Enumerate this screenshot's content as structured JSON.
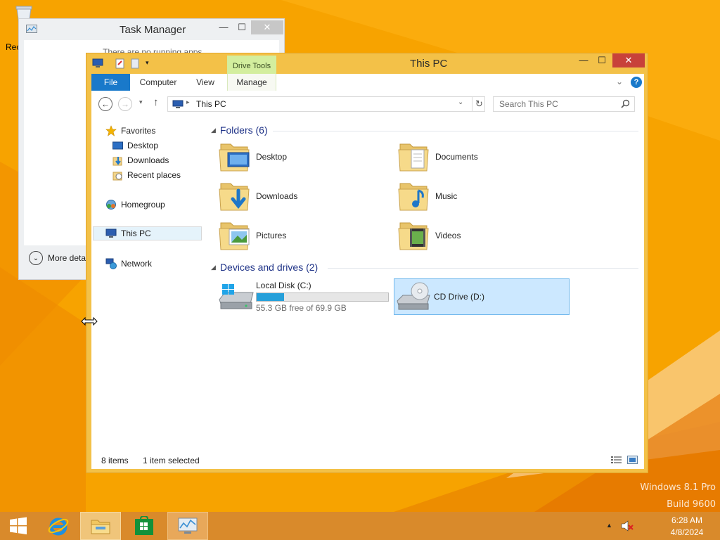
{
  "desktop": {
    "recycle_bin_label": "Rec",
    "watermark_line1": "Windows 8.1 Pro",
    "watermark_line2": "Build 9600"
  },
  "task_manager": {
    "title": "Task Manager",
    "empty_message": "There are no running apps",
    "more_details_label": "More deta",
    "controls": {
      "minimize": "—",
      "maximize": "☐",
      "close": "✕"
    }
  },
  "explorer": {
    "title": "This PC",
    "contextual_tab_group": "Drive Tools",
    "ribbon_tabs": [
      {
        "label": "File"
      },
      {
        "label": "Computer"
      },
      {
        "label": "View"
      },
      {
        "label": "Manage"
      }
    ],
    "help_label": "?",
    "controls": {
      "minimize": "—",
      "maximize": "☐",
      "close": "✕"
    },
    "address": {
      "path": "This PC"
    },
    "search": {
      "placeholder": "Search This PC"
    },
    "nav_pane": {
      "favorites": {
        "label": "Favorites",
        "items": [
          "Desktop",
          "Downloads",
          "Recent places"
        ]
      },
      "homegroup": "Homegroup",
      "this_pc": "This PC",
      "network": "Network"
    },
    "groups": {
      "folders": {
        "header": "Folders (6)",
        "items": [
          "Desktop",
          "Documents",
          "Downloads",
          "Music",
          "Pictures",
          "Videos"
        ]
      },
      "drives": {
        "header": "Devices and drives (2)",
        "items": [
          {
            "label": "Local Disk (C:)",
            "free_text": "55.3 GB free of 69.9 GB",
            "used_fraction": 0.209
          },
          {
            "label": "CD Drive (D:)"
          }
        ]
      }
    },
    "status": {
      "item_count": "8 items",
      "selected": "1 item selected"
    },
    "colors": {
      "accent": "#1979ca",
      "frame": "#f3c148",
      "selection": "#cce8ff",
      "drive_bar": "#26a0da",
      "group_header": "#1e3287"
    }
  },
  "taskbar": {
    "apps": [
      "start-icon",
      "internet-explorer-icon",
      "file-explorer-icon",
      "store-icon",
      "task-manager-icon"
    ],
    "time": "6:28 AM",
    "date": "4/8/2024"
  }
}
